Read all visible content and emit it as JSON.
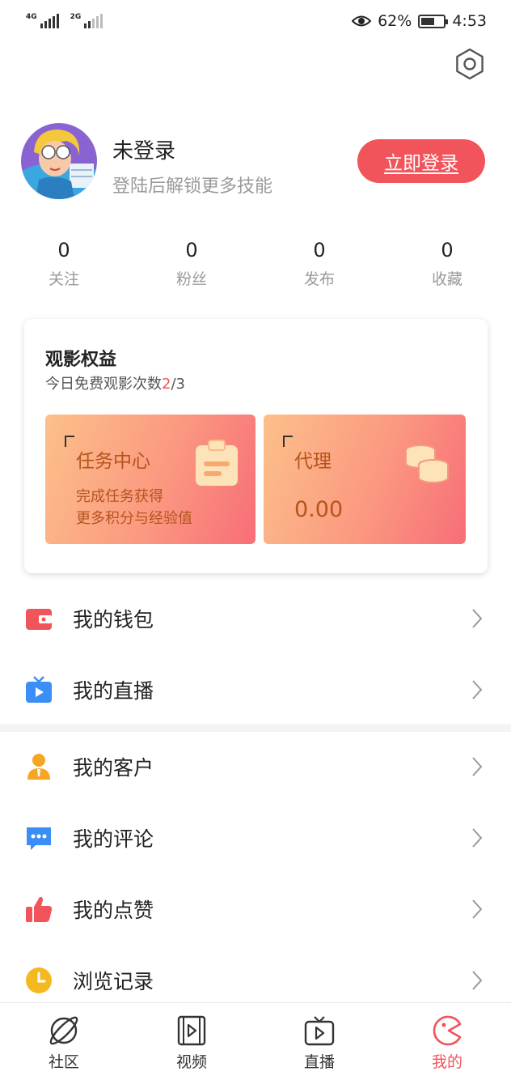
{
  "status_bar": {
    "signal1_type": "4G",
    "signal2_type": "2G",
    "battery_text": "62%",
    "battery_level": 0.62,
    "time": "4:53"
  },
  "profile": {
    "name": "未登录",
    "subtitle": "登陆后解锁更多技能",
    "login_label": "立即登录"
  },
  "stats": [
    {
      "value": "0",
      "label": "关注"
    },
    {
      "value": "0",
      "label": "粉丝"
    },
    {
      "value": "0",
      "label": "发布"
    },
    {
      "value": "0",
      "label": "收藏"
    }
  ],
  "benefits": {
    "title": "观影权益",
    "free_prefix": "今日免费观影次数",
    "free_used": "2",
    "free_total": "/3",
    "task_center": {
      "title": "任务中心",
      "line1": "完成任务获得",
      "line2": "更多积分与经验值"
    },
    "agent": {
      "title": "代理",
      "value": "0.00"
    }
  },
  "menu": [
    {
      "label": "我的钱包",
      "icon": "wallet-icon"
    },
    {
      "label": "我的直播",
      "icon": "tv-icon"
    },
    {
      "label": "我的客户",
      "icon": "customer-icon"
    },
    {
      "label": "我的评论",
      "icon": "comment-icon"
    },
    {
      "label": "我的点赞",
      "icon": "thumbs-up-icon"
    },
    {
      "label": "浏览记录",
      "icon": "clock-icon"
    }
  ],
  "tabs": [
    {
      "label": "社区",
      "icon": "planet-icon"
    },
    {
      "label": "视频",
      "icon": "film-icon"
    },
    {
      "label": "直播",
      "icon": "live-tv-icon"
    },
    {
      "label": "我的",
      "icon": "pacman-icon"
    }
  ],
  "colors": {
    "accent": "#f2545b",
    "tile_text": "#b5541c",
    "tv_blue": "#3a8ef5",
    "customer_orange": "#f5a623",
    "clock_yellow": "#f5b820"
  }
}
